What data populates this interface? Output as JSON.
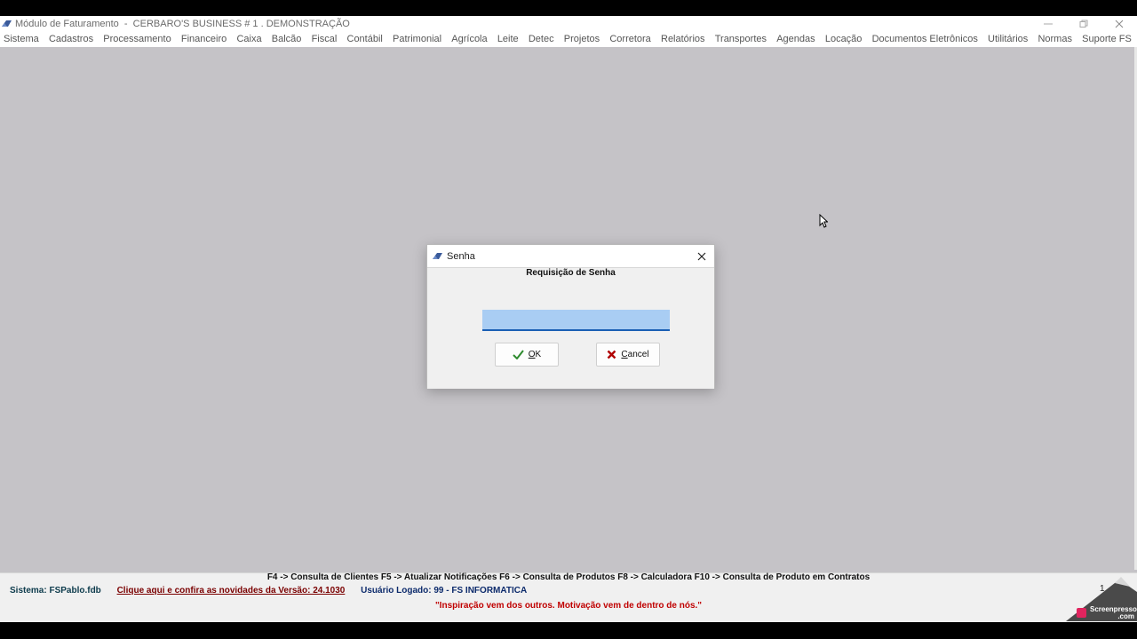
{
  "window": {
    "title": "Módulo de Faturamento  -  CERBARO'S BUSINESS # 1 . DEMONSTRAÇÃO",
    "controls": [
      "minimize-icon",
      "restore-icon",
      "close-icon"
    ]
  },
  "menu": {
    "items": [
      "Sistema",
      "Cadastros",
      "Processamento",
      "Financeiro",
      "Caixa",
      "Balcão",
      "Fiscal",
      "Contábil",
      "Patrimonial",
      "Agrícola",
      "Leite",
      "Detec",
      "Projetos",
      "Corretora",
      "Relatórios",
      "Transportes",
      "Agendas",
      "Locação",
      "Documentos Eletrônicos",
      "Utilitários",
      "Normas",
      "Suporte FS"
    ]
  },
  "dialog": {
    "title": "Senha",
    "heading": "Requisição de Senha",
    "password_value": "",
    "ok_label": "OK",
    "cancel_label": "Cancel"
  },
  "statusbar": {
    "shortcuts": "F4 -> Consulta de Clientes   F5 -> Atualizar Notificações   F6 -> Consulta de Produtos   F8 -> Calculadora   F10 -> Consulta de Produto em Contratos",
    "system": "Sistema: FSPablo.fdb",
    "news_link": "Clique aqui e confira as novidades da Versão: 24.1030",
    "user": "Usuário Logado: 99 - FS INFORMATICA",
    "motivation": "\"Inspiração vem dos outros. Motivação vem de dentro de nós.\"",
    "page_counter": "1"
  },
  "watermark": {
    "line1": "Screenpresso",
    "line2": ".com"
  },
  "colors": {
    "desktop": "#c5c3c7",
    "input_focus": "#a9cdf3",
    "ok_check": "#2e8b2e",
    "cancel_x": "#b00000",
    "motivation": "#c00000"
  }
}
